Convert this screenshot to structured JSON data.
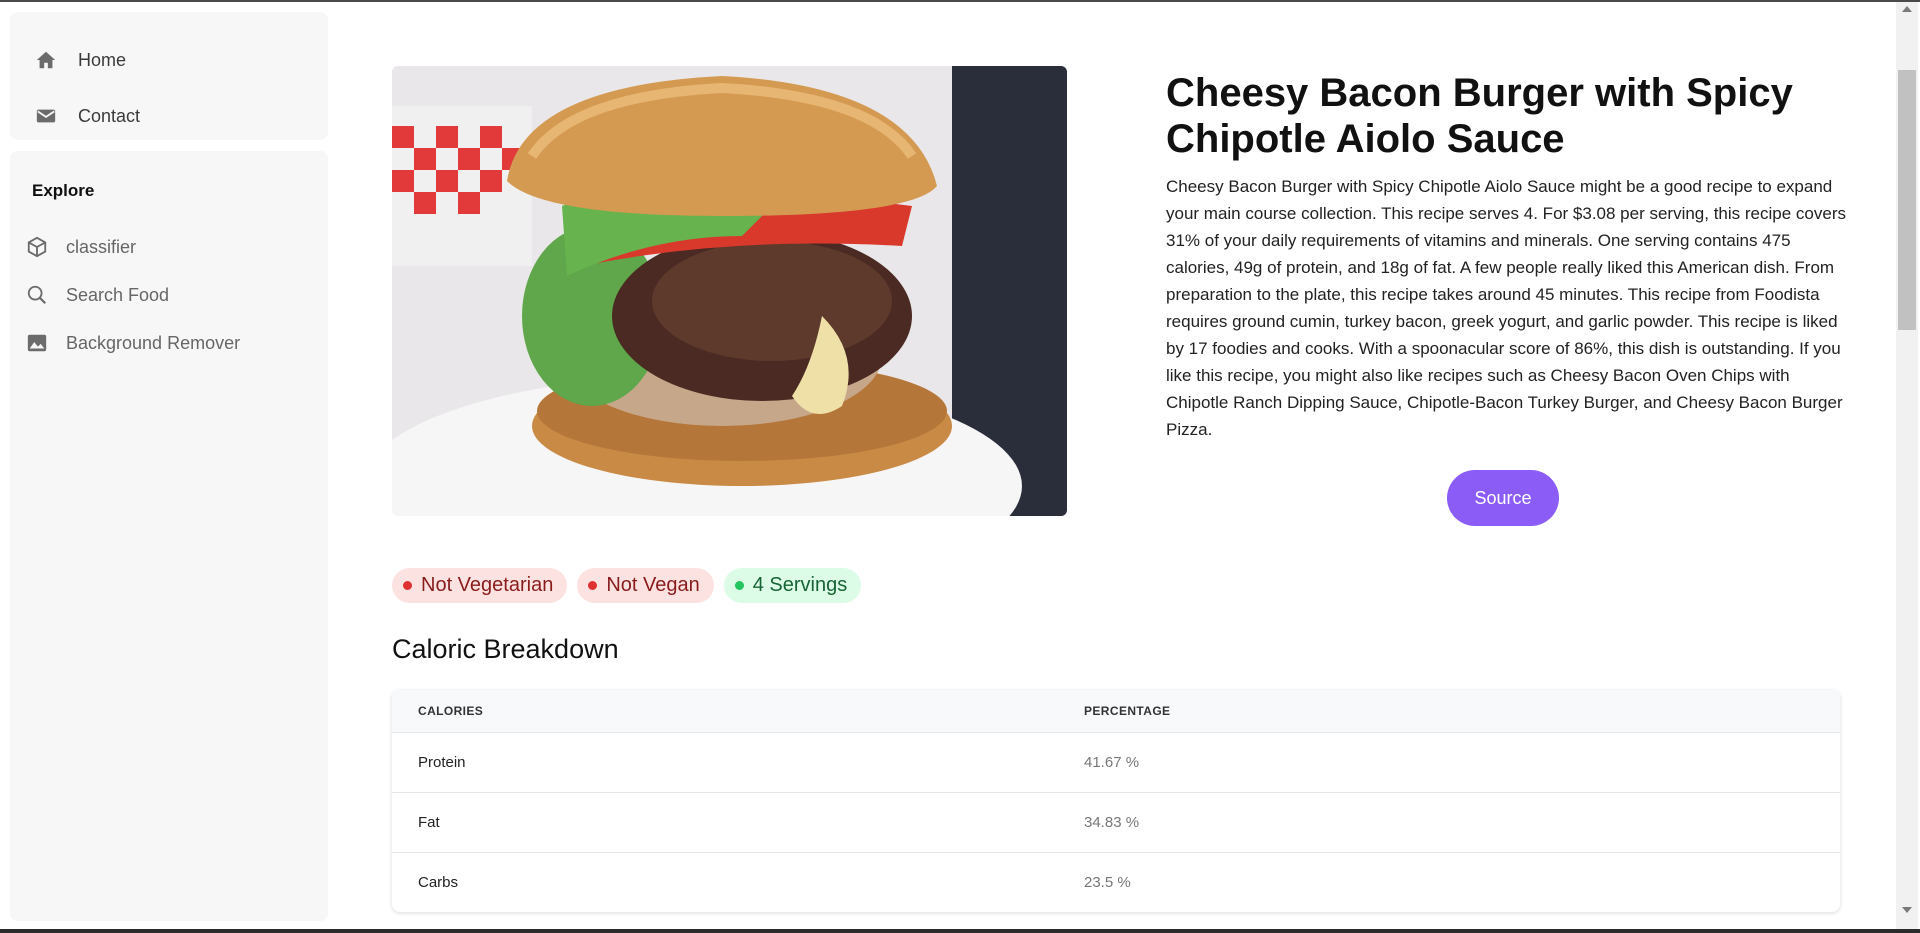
{
  "sidebar": {
    "nav": [
      {
        "label": "Home",
        "icon": "home-icon"
      },
      {
        "label": "Contact",
        "icon": "mail-icon"
      }
    ],
    "explore": {
      "title": "Explore",
      "items": [
        {
          "label": "classifier",
          "icon": "cube-icon"
        },
        {
          "label": "Search Food",
          "icon": "search-icon"
        },
        {
          "label": "Background Remover",
          "icon": "image-icon"
        }
      ]
    }
  },
  "recipe": {
    "title": "Cheesy Bacon Burger with Spicy Chipotle Aiolo Sauce",
    "description": "Cheesy Bacon Burger with Spicy Chipotle Aiolo Sauce might be a good recipe to expand your main course collection. This recipe serves 4. For $3.08 per serving, this recipe covers 31% of your daily requirements of vitamins and minerals. One serving contains 475 calories, 49g of protein, and 18g of fat. A few people really liked this American dish. From preparation to the plate, this recipe takes around 45 minutes. This recipe from Foodista requires ground cumin, turkey bacon, greek yogurt, and garlic powder. This recipe is liked by 17 foodies and cooks. With a spoonacular score of 86%, this dish is outstanding. If you like this recipe, you might also like recipes such as Cheesy Bacon Oven Chips with Chipotle Ranch Dipping Sauce, Chipotle-Bacon Turkey Burger, and Cheesy Bacon Burger Pizza.",
    "source_label": "Source",
    "badges": [
      {
        "label": "Not Vegetarian",
        "status": "red"
      },
      {
        "label": "Not Vegan",
        "status": "red"
      },
      {
        "label": "4 Servings",
        "status": "green"
      }
    ]
  },
  "caloric": {
    "title": "Caloric Breakdown",
    "headers": [
      "CALORIES",
      "PERCENTAGE"
    ],
    "rows": [
      {
        "name": "Protein",
        "value": "41.67 %"
      },
      {
        "name": "Fat",
        "value": "34.83 %"
      },
      {
        "name": "Carbs",
        "value": "23.5 %"
      }
    ]
  },
  "colors": {
    "accent": "#8b5cf6",
    "badge_red_bg": "#fde2e2",
    "badge_green_bg": "#dcfce7"
  }
}
